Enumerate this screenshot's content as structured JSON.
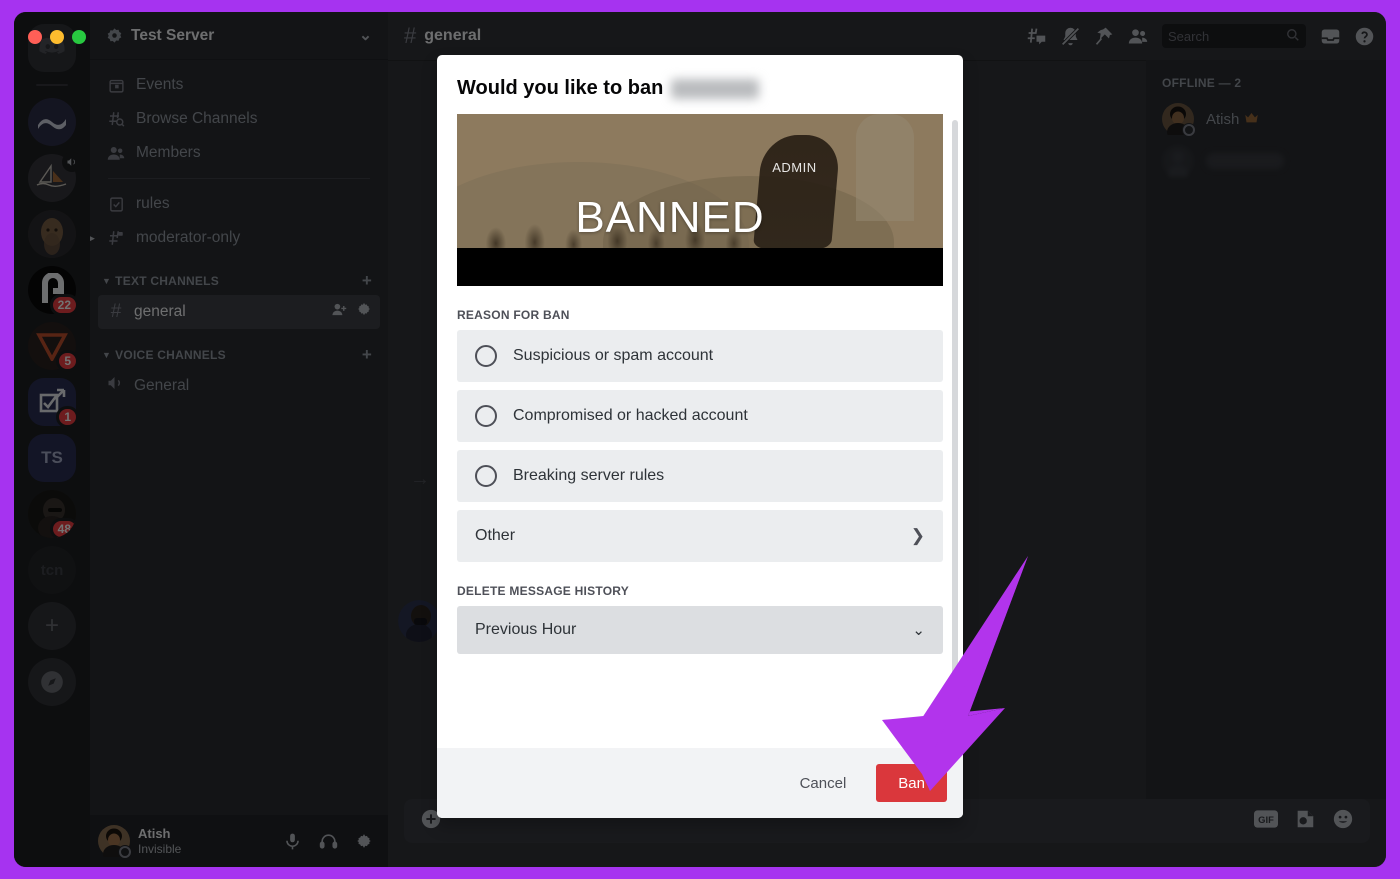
{
  "window": {
    "traffic_lights": [
      "close",
      "minimize",
      "maximize"
    ],
    "accent_purple": "#a633f0"
  },
  "server_rail": {
    "items": [
      {
        "name": "home",
        "label": "",
        "badge": ""
      },
      {
        "name": "server-wave",
        "label": "",
        "badge": ""
      },
      {
        "name": "server-boat",
        "label": "",
        "badge": ""
      },
      {
        "name": "server-portrait",
        "label": "",
        "badge": ""
      },
      {
        "name": "server-p",
        "label": "",
        "badge": "22"
      },
      {
        "name": "server-seven",
        "label": "",
        "badge": "5"
      },
      {
        "name": "server-check",
        "label": "",
        "badge": "1"
      },
      {
        "name": "server-ts",
        "label": "TS",
        "badge": ""
      },
      {
        "name": "server-avatar",
        "label": "",
        "badge": "48"
      },
      {
        "name": "server-tcn",
        "label": "tcn",
        "badge": ""
      },
      {
        "name": "add-server",
        "label": "+",
        "badge": ""
      },
      {
        "name": "explore-servers",
        "label": "",
        "badge": ""
      }
    ]
  },
  "sidebar": {
    "server_name": "Test Server",
    "nav_items": [
      {
        "label": "Events",
        "icon": "calendar-icon"
      },
      {
        "label": "Browse Channels",
        "icon": "browse-channels-icon"
      },
      {
        "label": "Members",
        "icon": "members-icon"
      }
    ],
    "special_channels": [
      {
        "label": "rules",
        "icon": "rules-icon"
      },
      {
        "label": "moderator-only",
        "icon": "locked-channel-icon"
      }
    ],
    "categories": [
      {
        "label": "TEXT CHANNELS",
        "add_label": "+",
        "channels": [
          {
            "label": "general",
            "prefix": "#",
            "active": true
          }
        ]
      },
      {
        "label": "VOICE CHANNELS",
        "add_label": "+",
        "channels": [
          {
            "label": "General",
            "prefix": "speaker",
            "active": false
          }
        ]
      }
    ]
  },
  "user_panel": {
    "name": "Atish",
    "status": "Invisible",
    "controls": [
      "microphone-icon",
      "headphones-icon",
      "settings-icon"
    ]
  },
  "chat_header": {
    "channel_prefix": "#",
    "channel_name": "general",
    "tools": [
      "threads-icon",
      "notifications-muted-icon",
      "pinned-messages-icon",
      "member-list-icon",
      "inbox-icon",
      "help-icon"
    ]
  },
  "search": {
    "placeholder": "Search",
    "value": ""
  },
  "composer": {
    "icons": [
      "gif-icon",
      "sticker-icon",
      "emoji-icon"
    ]
  },
  "member_list": {
    "category": "OFFLINE — 2",
    "members": [
      {
        "name": "Atish",
        "owner": true,
        "blurred": false
      },
      {
        "name": "",
        "owner": false,
        "blurred": true
      }
    ]
  },
  "modal": {
    "title_prefix": "Would you like to ban",
    "username_blurred": true,
    "banner": {
      "overlay_text": "BANNED",
      "label_text": "ADMIN"
    },
    "reason_section_label": "REASON FOR BAN",
    "reasons": [
      {
        "label": "Suspicious or spam account",
        "type": "radio",
        "selected": false
      },
      {
        "label": "Compromised or hacked account",
        "type": "radio",
        "selected": false
      },
      {
        "label": "Breaking server rules",
        "type": "radio",
        "selected": false
      },
      {
        "label": "Other",
        "type": "submenu",
        "selected": false
      }
    ],
    "delete_history_label": "DELETE MESSAGE HISTORY",
    "delete_history_value": "Previous Hour",
    "cancel_label": "Cancel",
    "ban_label": "Ban",
    "ban_button_color": "#da373c"
  }
}
